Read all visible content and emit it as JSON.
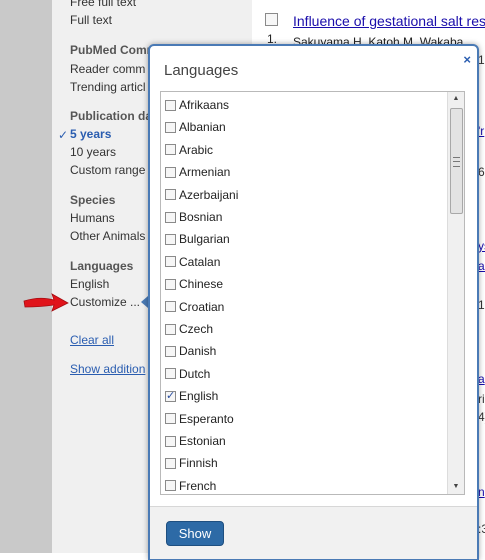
{
  "sidebar": {
    "free_full_text": "Free full text",
    "full_text": "Full text",
    "pubmed_commons_head": "PubMed Comm",
    "reader_comments": "Reader comm",
    "trending_articles": "Trending articl",
    "pub_date_head": "Publication da",
    "five_years": "5 years",
    "ten_years": "10 years",
    "custom_range": "Custom range",
    "species_head": "Species",
    "humans": "Humans",
    "other_animals": "Other Animals",
    "languages_head": "Languages",
    "english": "English",
    "customize": "Customize ...",
    "clear_all": "Clear all",
    "show_additional": "Show addition"
  },
  "result": {
    "title": "Influence of gestational salt res",
    "number": "1.",
    "authors": "Sakuyama H, Katoh M, Wakaba",
    "fragments": [
      "12",
      "'r",
      "6(",
      "ys",
      "as",
      "10",
      "a",
      "ri",
      "4)",
      "n",
      ":3"
    ]
  },
  "dialog": {
    "title": "Languages",
    "close": "×",
    "show_button": "Show",
    "languages": [
      {
        "label": "Afrikaans",
        "checked": false
      },
      {
        "label": "Albanian",
        "checked": false
      },
      {
        "label": "Arabic",
        "checked": false
      },
      {
        "label": "Armenian",
        "checked": false
      },
      {
        "label": "Azerbaijani",
        "checked": false
      },
      {
        "label": "Bosnian",
        "checked": false
      },
      {
        "label": "Bulgarian",
        "checked": false
      },
      {
        "label": "Catalan",
        "checked": false
      },
      {
        "label": "Chinese",
        "checked": false
      },
      {
        "label": "Croatian",
        "checked": false
      },
      {
        "label": "Czech",
        "checked": false
      },
      {
        "label": "Danish",
        "checked": false
      },
      {
        "label": "Dutch",
        "checked": false
      },
      {
        "label": "English",
        "checked": true
      },
      {
        "label": "Esperanto",
        "checked": false
      },
      {
        "label": "Estonian",
        "checked": false
      },
      {
        "label": "Finnish",
        "checked": false
      },
      {
        "label": "French",
        "checked": false
      }
    ]
  },
  "colors": {
    "link": "#2a5db0",
    "dialog_border": "#4a7ab5",
    "button": "#2d6aa6",
    "arrow": "#e0141b"
  },
  "icons": {
    "close": "close-icon",
    "checkmark": "checkmark-icon",
    "annotation_arrow": "red-arrow-icon"
  }
}
